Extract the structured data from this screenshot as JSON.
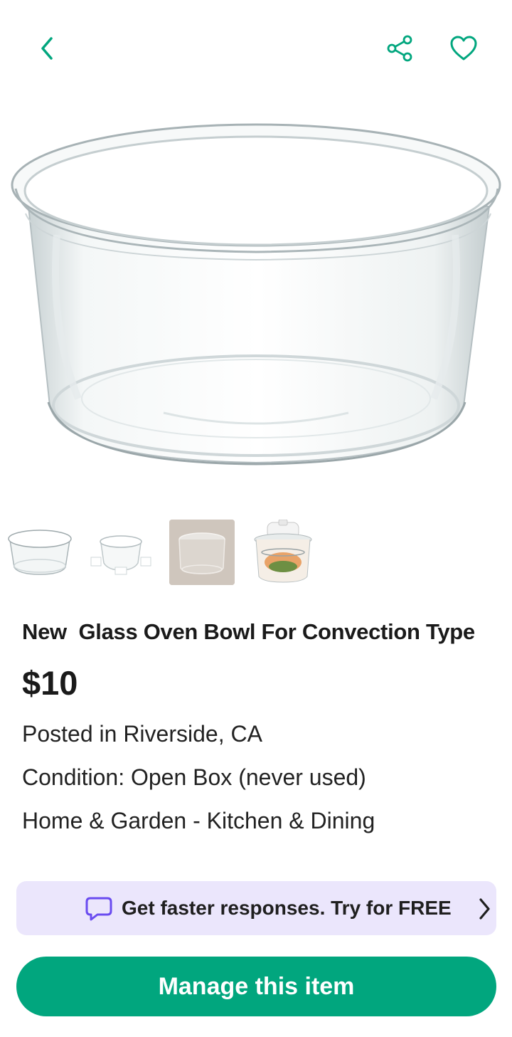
{
  "colors": {
    "accent": "#01a67e",
    "promo_bg": "#ebe6fc",
    "promo_icon": "#6a4cf0"
  },
  "icons": {
    "back": "chevron-left-icon",
    "share": "share-icon",
    "favorite": "heart-icon",
    "promo": "chat-bubble-icon",
    "promo_arrow": "chevron-right-icon"
  },
  "gallery": {
    "thumbnails": [
      "glass bowl",
      "bowl with clips",
      "bowl on stand",
      "convection oven"
    ]
  },
  "listing": {
    "title": "New  Glass Oven Bowl For Convection Type",
    "price": "$10",
    "location": "Posted in Riverside, CA",
    "condition": "Condition: Open Box (never used)",
    "category": "Home & Garden - Kitchen & Dining"
  },
  "promo": {
    "text": "Get faster responses. Try for FREE"
  },
  "actions": {
    "manage_label": "Manage this item"
  }
}
